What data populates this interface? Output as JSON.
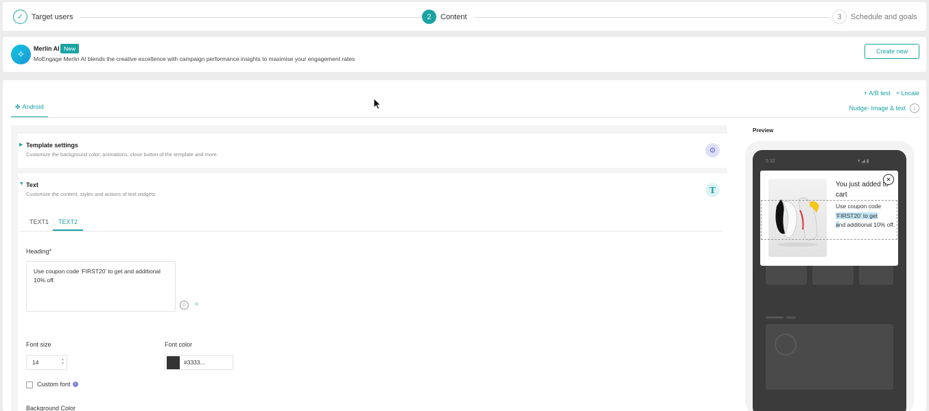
{
  "stepper": {
    "steps": [
      {
        "label": "Target users",
        "marker": "✓",
        "state": "done"
      },
      {
        "label": "Content",
        "marker": "2",
        "state": "active"
      },
      {
        "label": "Schedule and goals",
        "marker": "3",
        "state": "pending"
      }
    ]
  },
  "merlin": {
    "title": "Merlin AI",
    "badge": "New",
    "description": "MoEngage Merlin AI blends the creative excellence with campaign performance insights to maximise your engagement rates",
    "create_button": "Create new",
    "logo_icon": "magic-wand-icon"
  },
  "main": {
    "platform_tab": "Android",
    "actions": {
      "ab_test": "+ A/B test",
      "locale": "+ Locale"
    },
    "template_type": "Nudge- Image & text",
    "template_settings": {
      "title": "Template settings",
      "subtitle": "Customize the background color, animations, close button of the template and more."
    },
    "text_section": {
      "title": "Text",
      "subtitle": "Customize the content, styles and actions of text widgets",
      "icon_letter": "T",
      "tabs": [
        "TEXT1",
        "TEXT2"
      ],
      "active_tab": "TEXT2",
      "heading_label": "Heading*",
      "heading_value": "Use coupon code ‘FIRST20’ to get and additional 10% off.",
      "font_size_label": "Font size",
      "font_size_value": "14",
      "font_color_label": "Font color",
      "font_color_value": "#3333...",
      "custom_font_label": "Custom font",
      "background_color_label": "Background Color"
    }
  },
  "preview": {
    "label": "Preview",
    "time": "5:32",
    "status_icons": "▾◢▮",
    "nudge_title": "You just added to cart",
    "nudge_text_plain": "Use coupon code ",
    "nudge_text_highlight_1": "‘FIRST20’ to get",
    "nudge_text_highlight_2": "a",
    "nudge_text_rest": "nd additional 10% off.",
    "close_symbol": "✕"
  }
}
